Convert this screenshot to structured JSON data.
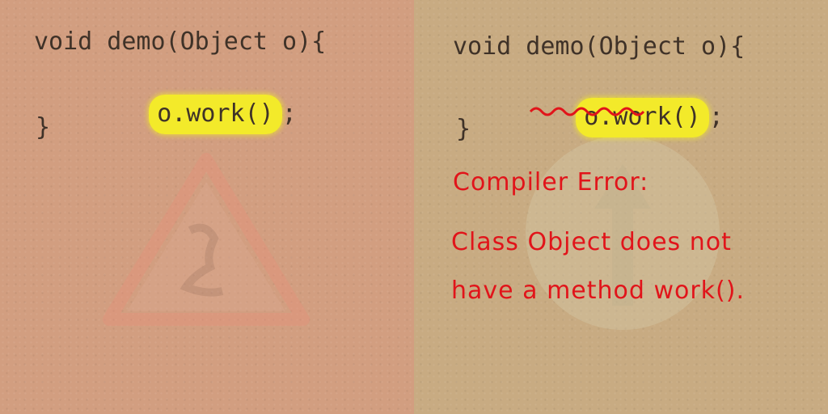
{
  "left_panel": {
    "lines": [
      "void demo(Object o){",
      "o.work()",
      ";",
      "}"
    ]
  },
  "right_panel": {
    "lines": [
      "void demo(Object o){",
      "o.work()",
      ";",
      "}"
    ],
    "error_title": "Compiler Error:",
    "error_line1": "Class Object does not",
    "error_line2": "have a method work()."
  },
  "colors": {
    "ink": "#3f3228",
    "highlight": "#f3ea2a",
    "error": "#e1141a",
    "left_bg": "#d29e80",
    "right_bg": "#c8ab82"
  },
  "icons": {
    "left_watermark": "warning-triangle-icon",
    "right_watermark": "up-arrow-circle-icon"
  }
}
